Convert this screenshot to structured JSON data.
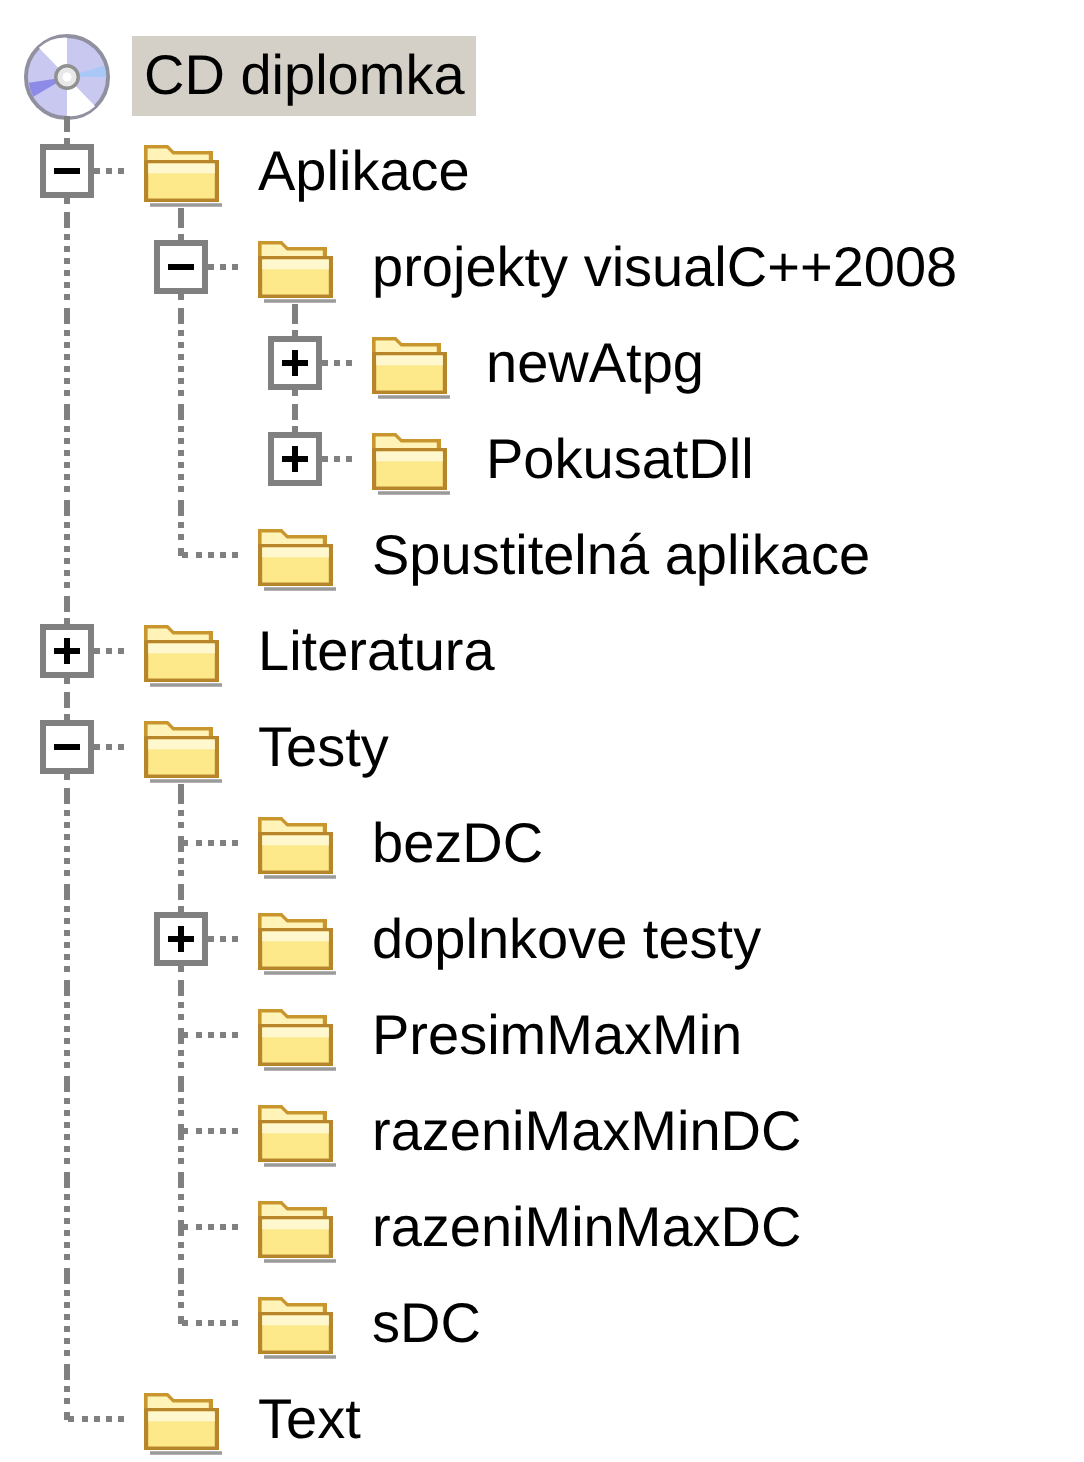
{
  "tree": {
    "label": "CD diplomka",
    "selected": true,
    "children": [
      {
        "label": "Aplikace",
        "selected": false,
        "expanded": true,
        "children": [
          {
            "label": "projekty visualC++2008",
            "selected": false,
            "expanded": true,
            "children": [
              {
                "label": "newAtpg",
                "selected": false,
                "expanded": false
              },
              {
                "label": "PokusatDll",
                "selected": false,
                "expanded": false
              }
            ]
          },
          {
            "label": "Spustitelná aplikace",
            "selected": false
          }
        ]
      },
      {
        "label": "Literatura",
        "selected": false,
        "expanded": false
      },
      {
        "label": "Testy",
        "selected": false,
        "expanded": true,
        "children": [
          {
            "label": "bezDC",
            "selected": false
          },
          {
            "label": "doplnkove testy",
            "selected": false,
            "expanded": false
          },
          {
            "label": "PresimMaxMin",
            "selected": false
          },
          {
            "label": "razeniMaxMinDC",
            "selected": false
          },
          {
            "label": "razeniMinMaxDC",
            "selected": false
          },
          {
            "label": "sDC",
            "selected": false
          }
        ]
      },
      {
        "label": "Text",
        "selected": false
      }
    ]
  }
}
